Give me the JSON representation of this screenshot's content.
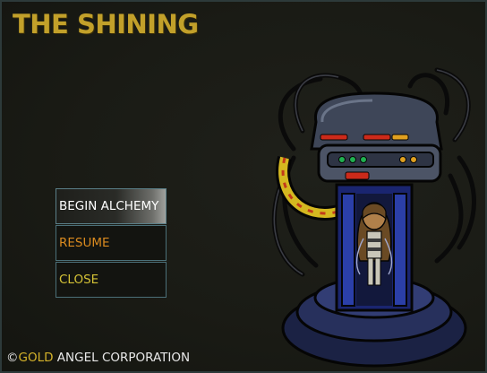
{
  "game": {
    "title": "THE SHINING"
  },
  "menu": {
    "items": [
      {
        "label": "BEGIN ALCHEMY"
      },
      {
        "label": "RESUME"
      },
      {
        "label": "CLOSE"
      }
    ]
  },
  "footer": {
    "copyright_symbol": "©",
    "gold": "GOLD",
    "rest": " ANGEL CORPORATION"
  },
  "colors": {
    "title": "#c2a02a",
    "resume": "#d98a1f",
    "close": "#d4c236",
    "machine_body": "#5a6274",
    "capsule": "#2a3a88"
  }
}
